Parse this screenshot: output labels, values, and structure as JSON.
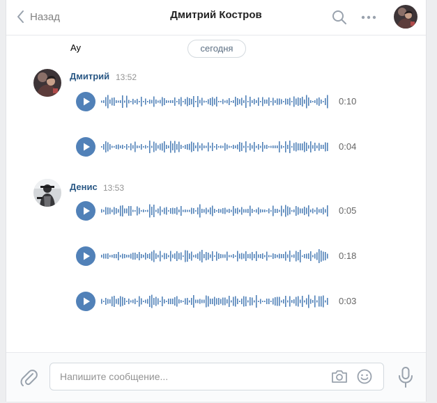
{
  "header": {
    "back_label": "Назад",
    "title": "Дмитрий Костров",
    "icons": [
      "back-chevron-icon",
      "search-icon",
      "more-icon",
      "avatar"
    ]
  },
  "chat": {
    "previous_message": "Ау",
    "date_separator": "сегодня",
    "groups": [
      {
        "author": "Дмитрий",
        "time": "13:52",
        "voice_messages": [
          {
            "duration": "0:10"
          },
          {
            "duration": "0:04"
          }
        ]
      },
      {
        "author": "Денис",
        "time": "13:53",
        "voice_messages": [
          {
            "duration": "0:05"
          },
          {
            "duration": "0:18"
          },
          {
            "duration": "0:03"
          }
        ]
      }
    ]
  },
  "composer": {
    "placeholder": "Напишите сообщение...",
    "value": "",
    "icons": [
      "attach-icon",
      "camera-icon",
      "emoji-icon",
      "microphone-icon"
    ]
  },
  "colors": {
    "accent": "#5181b8",
    "link": "#2a5885",
    "waveform": "#5181b8",
    "muted": "#939393",
    "background": "#edeef0"
  }
}
